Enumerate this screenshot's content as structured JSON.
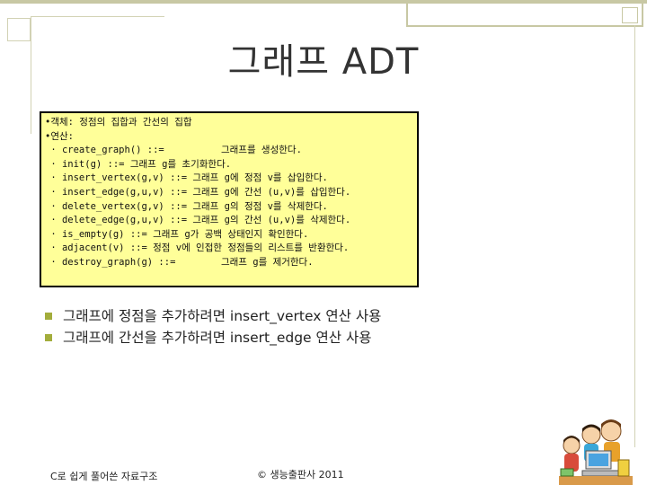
{
  "title": "그래프 ADT",
  "code_lines": [
    "•객체: 정점의 집합과 간선의 집합",
    "•연산:",
    " · create_graph() ::=          그래프를 생성한다.",
    " · init(g) ::= 그래프 g를 초기화한다.",
    " · insert_vertex(g,v) ::= 그래프 g에 정점 v를 삽입한다.",
    " · insert_edge(g,u,v) ::= 그래프 g에 간선 (u,v)를 삽입한다.",
    " · delete_vertex(g,v) ::= 그래프 g의 정점 v를 삭제한다.",
    " · delete_edge(g,u,v) ::= 그래프 g의 간선 (u,v)를 삭제한다.",
    " · is_empty(g) ::= 그래프 g가 공백 상태인지 확인한다.",
    " · adjacent(v) ::= 정점 v에 인접한 정점들의 리스트를 반환한다.",
    " · destroy_graph(g) ::=        그래프 g를 제거한다."
  ],
  "bullets": [
    "그래프에 정점을 추가하려면 insert_vertex 연산 사용",
    "그래프에 간선을 추가하려면 insert_edge 연산 사용"
  ],
  "footer": {
    "left": "C로 쉽게 풀어쓴 자료구조",
    "center": "© 생능출판사 2011"
  },
  "colors": {
    "code_background": "#ffff99",
    "bullet_marker": "#a3ad3c",
    "decor": "#c8c8a4"
  },
  "icons": {
    "illustration": "children-with-computer-icon"
  }
}
